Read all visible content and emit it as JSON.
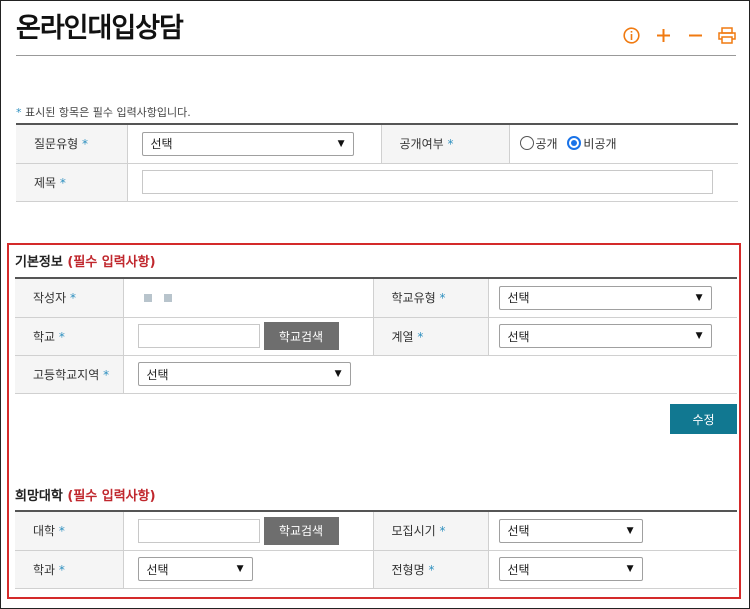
{
  "header": {
    "title": "온라인대입상담"
  },
  "toolbar": {
    "info_icon": "info-icon",
    "zoom_in_icon": "plus-icon",
    "zoom_out_icon": "minus-icon",
    "print_icon": "print-icon"
  },
  "note": {
    "star": "*",
    "text": " 표시된 항목은 필수 입력사항입니다."
  },
  "question": {
    "type_label": "질문유형",
    "type_value": "선택",
    "public_label": "공개여부",
    "public_option": "공개",
    "private_option": "비공개",
    "selected": "비공개",
    "subject_label": "제목",
    "subject_value": ""
  },
  "basic": {
    "title": "기본정보",
    "req": "(필수 입력사항)",
    "writer_label": "작성자",
    "school_type_label": "학교유형",
    "school_type_value": "선택",
    "school_label": "학교",
    "school_value": "",
    "search_btn": "학교검색",
    "track_label": "계열",
    "track_value": "선택",
    "region_label": "고등학교지역",
    "region_value": "선택",
    "edit_btn": "수정"
  },
  "hope": {
    "title": "희망대학",
    "req": "(필수 입력사항)",
    "univ_label": "대학",
    "univ_value": "",
    "search_btn": "학교검색",
    "period_label": "모집시기",
    "period_value": "선택",
    "major_label": "학과",
    "major_value": "선택",
    "admission_label": "전형명",
    "admission_value": "선택"
  },
  "req_star": "*",
  "colors": {
    "accent": "#f07a10",
    "star": "#2d8fbf",
    "required_red": "#c0272d",
    "highlight_border": "#d42a2a",
    "edit_button": "#117891"
  }
}
